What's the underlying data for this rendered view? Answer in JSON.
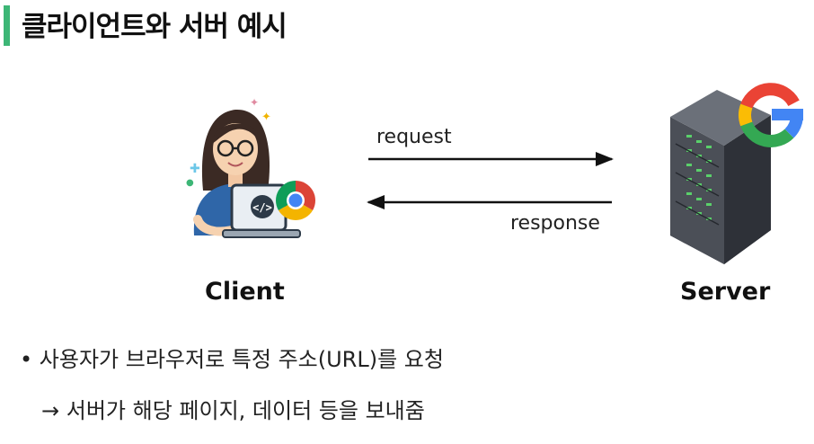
{
  "title": "클라이언트와 서버 예시",
  "diagram": {
    "request_label": "request",
    "response_label": "response",
    "client_label": "Client",
    "server_label": "Server",
    "client_icon": "developer-with-laptop-icon",
    "browser_icon": "chrome-icon",
    "server_icon": "server-rack-icon",
    "search_icon": "google-icon"
  },
  "notes": {
    "bullet_mark": "•",
    "line1": "사용자가 브라우저로 특정 주소(URL)를 요청",
    "arrow_mark": "→",
    "line2": "서버가 해당 페이지, 데이터 등을 보내줌"
  },
  "colors": {
    "accent": "#3db676",
    "arrow": "#111111"
  }
}
